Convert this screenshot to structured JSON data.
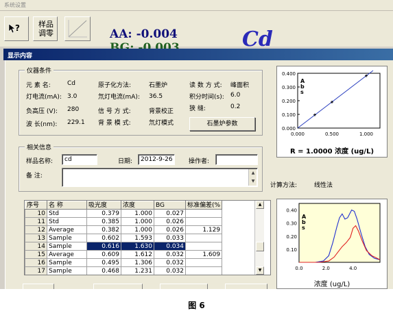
{
  "window": {
    "menu_label": "系统设置",
    "dialog_title": "显示内容"
  },
  "toolbar": {
    "help_icon": "?",
    "zero_label_1": "样品",
    "zero_label_2": "调零",
    "curve_icon": "calibration-curve-icon",
    "aa_readout": "AA: -0.004",
    "bg_readout": "BG: -0.003",
    "element_symbol": "Cd"
  },
  "instrument": {
    "group_title": "仪器条件",
    "element_label": "元  素  名:",
    "element_value": "Cd",
    "lamp_current_label": "灯电流(mA):",
    "lamp_current_value": "3.0",
    "voltage_label": "负高压  (V):",
    "voltage_value": "280",
    "wavelength_label": "波    长(nm):",
    "wavelength_value": "229.1",
    "atomization_label": "原子化方法:",
    "atomization_value": "石墨炉",
    "cathode_label": "氘灯电流(mA):",
    "cathode_value": "36.5",
    "signal_label": "信 号 方 式:",
    "signal_value": "背景校正",
    "background_label": "背 景 模 式:",
    "background_value": "氘灯模式",
    "read_mode_label": "读 数 方 式:",
    "read_mode_value": "峰面积",
    "integration_label": "积分时间(s):",
    "integration_value": "6.0",
    "slit_label": "狭         缝:",
    "slit_value": "0.2",
    "furnace_button": "石墨炉参数"
  },
  "related": {
    "group_title": "相关信息",
    "sample_name_label": "样品名称:",
    "sample_name_value": "cd",
    "date_label": "日期:",
    "date_value": "2012-9-26",
    "operator_label": "操作者:",
    "operator_value": "",
    "remark_label": "备    注:",
    "remark_value": ""
  },
  "table": {
    "columns": [
      "序号",
      "名 称",
      "吸光度",
      "浓度",
      "BG",
      "标准偏差(%"
    ],
    "rows": [
      [
        "10",
        "Std",
        "0.379",
        "1.000",
        "0.027",
        ""
      ],
      [
        "11",
        "Std",
        "0.385",
        "1.000",
        "0.026",
        ""
      ],
      [
        "12",
        "Average",
        "0.382",
        "1.000",
        "0.026",
        "1.129"
      ],
      [
        "13",
        "Sample",
        "0.602",
        "1.593",
        "0.033",
        ""
      ],
      [
        "14",
        "Sample",
        "0.616",
        "1.630",
        "0.034",
        ""
      ],
      [
        "15",
        "Average",
        "0.609",
        "1.612",
        "0.032",
        "1.609"
      ],
      [
        "16",
        "Sample",
        "0.495",
        "1.306",
        "0.032",
        ""
      ],
      [
        "17",
        "Sample",
        "0.468",
        "1.231",
        "0.032",
        ""
      ]
    ],
    "selected_row": 4
  },
  "calc": {
    "label": "计算方法:",
    "value": "线性法"
  },
  "caption": "图 6",
  "chart_data": [
    {
      "type": "line",
      "title": "",
      "xlabel": "浓度 (ug/L)",
      "ylabel": "Abs",
      "xlim": [
        0,
        1.2
      ],
      "ylim": [
        0,
        0.4
      ],
      "x_ticks": [
        "0.000",
        "0.500",
        "1.000"
      ],
      "y_ticks": [
        "0.000",
        "0.100",
        "0.200",
        "0.300",
        "0.400"
      ],
      "points": [
        {
          "x": 0.25,
          "y": 0.097
        },
        {
          "x": 0.5,
          "y": 0.19
        },
        {
          "x": 1.0,
          "y": 0.382
        }
      ],
      "fit_line": [
        {
          "x": 0.0,
          "y": 0.0
        },
        {
          "x": 1.1,
          "y": 0.42
        }
      ],
      "annotation": "R = 1.0000",
      "line_color": "#2a3fbf"
    },
    {
      "type": "line",
      "title": "",
      "xlabel": "浓度 (ug/L)",
      "ylabel": "Abs",
      "xlim": [
        0,
        6
      ],
      "ylim": [
        0,
        0.45
      ],
      "x_ticks": [
        "0.0",
        "2.0",
        "4.0"
      ],
      "y_ticks": [
        "0.10",
        "0.20",
        "0.30",
        "0.40"
      ],
      "series": [
        {
          "color": "#2030d0",
          "points": [
            [
              0.0,
              0.0
            ],
            [
              1.2,
              0.0
            ],
            [
              1.8,
              0.01
            ],
            [
              2.2,
              0.05
            ],
            [
              2.5,
              0.15
            ],
            [
              2.8,
              0.27
            ],
            [
              3.0,
              0.34
            ],
            [
              3.2,
              0.37
            ],
            [
              3.4,
              0.33
            ],
            [
              3.6,
              0.34
            ],
            [
              3.9,
              0.4
            ],
            [
              4.1,
              0.39
            ],
            [
              4.3,
              0.33
            ],
            [
              4.6,
              0.22
            ],
            [
              4.9,
              0.12
            ],
            [
              5.2,
              0.06
            ],
            [
              5.6,
              0.03
            ],
            [
              6.0,
              0.02
            ]
          ]
        },
        {
          "color": "#e02020",
          "points": [
            [
              0.0,
              0.0
            ],
            [
              1.5,
              0.0
            ],
            [
              2.2,
              0.01
            ],
            [
              2.6,
              0.04
            ],
            [
              2.9,
              0.08
            ],
            [
              3.2,
              0.12
            ],
            [
              3.5,
              0.15
            ],
            [
              3.8,
              0.19
            ],
            [
              4.0,
              0.26
            ],
            [
              4.2,
              0.28
            ],
            [
              4.4,
              0.24
            ],
            [
              4.7,
              0.16
            ],
            [
              5.0,
              0.09
            ],
            [
              5.4,
              0.05
            ],
            [
              5.8,
              0.03
            ],
            [
              6.0,
              0.02
            ]
          ]
        }
      ],
      "background": "#ffffd8"
    }
  ]
}
